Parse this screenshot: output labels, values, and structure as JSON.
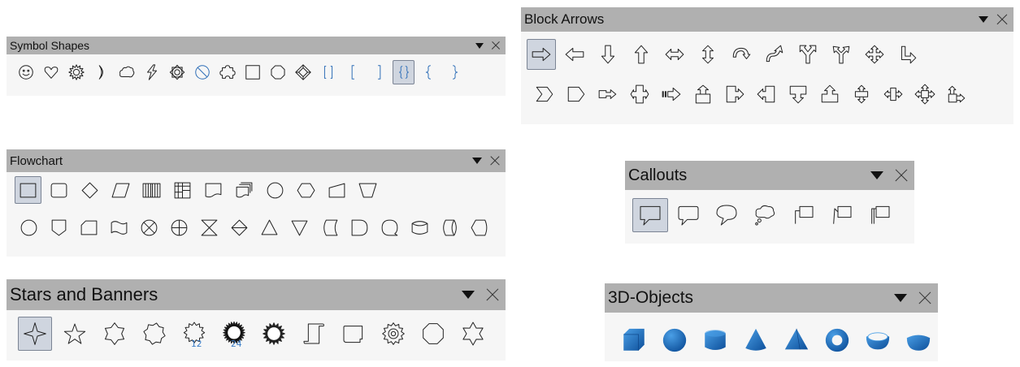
{
  "symbol_shapes": {
    "title": "Symbol Shapes",
    "items": [
      "smiley",
      "heart",
      "sun",
      "moon",
      "cloud",
      "lightning",
      "flower",
      "forbidden",
      "puzzle",
      "square-bevel",
      "octagon-bevel",
      "diamond-bevel",
      "double-bracket",
      "left-bracket",
      "right-bracket",
      "double-brace",
      "left-brace",
      "right-brace"
    ],
    "selected": "double-brace"
  },
  "block_arrows": {
    "title": "Block Arrows",
    "rows": [
      [
        "right-arrow",
        "left-arrow",
        "down-arrow",
        "up-arrow",
        "left-right-arrow",
        "up-down-arrow",
        "circular-arrow",
        "s-shaped-arrow",
        "split-arrow",
        "up-right-arrow",
        "four-way-arrow",
        "corner-right-arrow"
      ],
      [
        "chevron",
        "pentagon",
        "right-arrow-callout",
        "left-right-arrow-callout",
        "striped-right-arrow",
        "up-arrow-callout",
        "right-arrow-box",
        "left-arrow-box",
        "down-arrow-callout",
        "up-arrow-box",
        "up-down-arrow-callout",
        "left-right-arrow-box",
        "four-way-arrow-callout",
        "up-right-arrow-callout"
      ]
    ],
    "selected": "right-arrow"
  },
  "flowchart": {
    "title": "Flowchart",
    "rows": [
      [
        "process",
        "alternate-process",
        "decision",
        "data",
        "predefined-process",
        "internal-storage",
        "document",
        "multidocument",
        "terminator",
        "preparation",
        "manual-input",
        "manual-operation"
      ],
      [
        "connector",
        "off-page-connector",
        "card",
        "punched-tape",
        "summing-junction",
        "or",
        "collate",
        "sort",
        "extract",
        "merge",
        "stored-data",
        "delay",
        "sequential-access",
        "magnetic-disc",
        "direct-access-storage",
        "display"
      ]
    ],
    "selected": "process"
  },
  "callouts": {
    "title": "Callouts",
    "items": [
      "rectangular-callout",
      "rounded-rectangular-callout",
      "round-callout",
      "cloud-callout",
      "line-callout-1",
      "line-callout-2",
      "line-callout-3"
    ],
    "selected": "rectangular-callout"
  },
  "stars_banners": {
    "title": "Stars and Banners",
    "items": [
      "4-point-star",
      "5-point-star",
      "6-point-star",
      "8-point-star",
      "12-point-star",
      "24-point-star",
      "explosion",
      "vertical-scroll",
      "horizontal-scroll",
      "signet",
      "doorplate",
      "concave-star"
    ],
    "selected": "4-point-star",
    "badges": {
      "12-point-star": "12",
      "24-point-star": "24"
    }
  },
  "objects_3d": {
    "title": "3D-Objects",
    "items": [
      "cube",
      "sphere",
      "cylinder",
      "cone",
      "pyramid",
      "torus",
      "shell",
      "half-sphere"
    ],
    "colors": {
      "light": "#4a9fe6",
      "dark": "#0d4f9a"
    }
  }
}
